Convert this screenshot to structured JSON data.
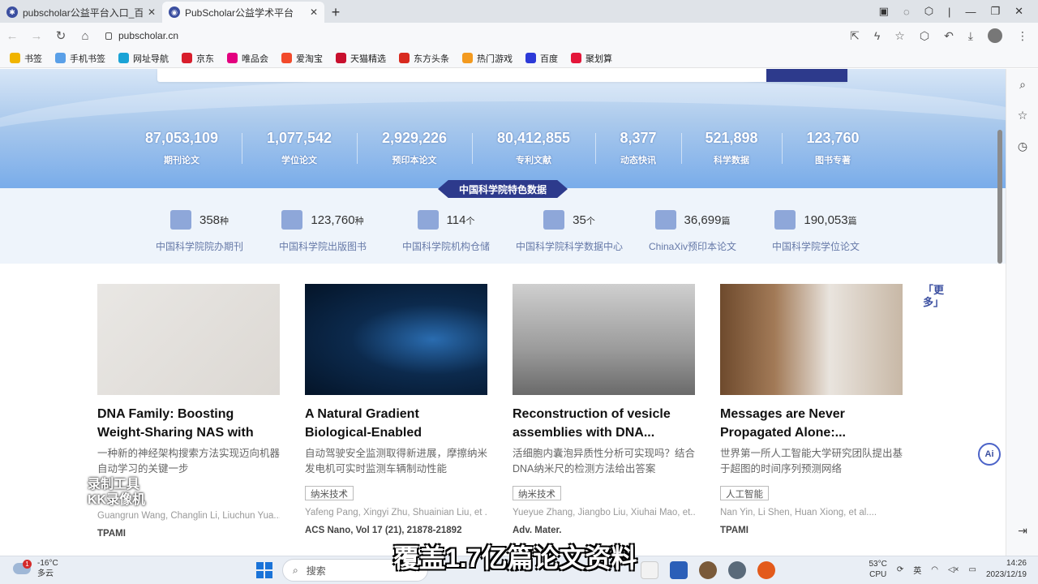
{
  "browser": {
    "tabs": [
      {
        "title": "pubscholar公益平台入口_百度搜",
        "active": false
      },
      {
        "title": "PubScholar公益学术平台",
        "active": true
      }
    ],
    "url": "pubscholar.cn"
  },
  "bookmarks": [
    {
      "label": "书签",
      "icon": "star-icon",
      "color": "#f0b400"
    },
    {
      "label": "手机书签",
      "icon": "folder-icon",
      "color": "#5aa0e8"
    },
    {
      "label": "网址导航",
      "icon": "edge-icon",
      "color": "#1aa3d6"
    },
    {
      "label": "京东",
      "icon": "jd-icon",
      "color": "#d81e2c"
    },
    {
      "label": "唯品会",
      "icon": "vip-icon",
      "color": "#e3007f"
    },
    {
      "label": "爱淘宝",
      "icon": "taobao-icon",
      "color": "#f24a2b"
    },
    {
      "label": "天猫精选",
      "icon": "tmall-icon",
      "color": "#c8102e"
    },
    {
      "label": "东方头条",
      "icon": "toutiao-icon",
      "color": "#d82a1f"
    },
    {
      "label": "热门游戏",
      "icon": "game-icon",
      "color": "#f39a1f"
    },
    {
      "label": "百度",
      "icon": "baidu-icon",
      "color": "#2d3ad8"
    },
    {
      "label": "聚划算",
      "icon": "juhuasuan-icon",
      "color": "#e4173a"
    }
  ],
  "stats": [
    {
      "value": "87,053,109",
      "label": "期刊论文"
    },
    {
      "value": "1,077,542",
      "label": "学位论文"
    },
    {
      "value": "2,929,226",
      "label": "预印本论文"
    },
    {
      "value": "80,412,855",
      "label": "专利文献"
    },
    {
      "value": "8,377",
      "label": "动态快讯"
    },
    {
      "value": "521,898",
      "label": "科学数据"
    },
    {
      "value": "123,760",
      "label": "图书专著"
    }
  ],
  "cas_section": {
    "title": "中国科学院特色数据",
    "items": [
      {
        "num": "358",
        "unit": "种",
        "label": "中国科学院院办期刊",
        "icon": "book-icon"
      },
      {
        "num": "123,760",
        "unit": "种",
        "label": "中国科学院出版图书",
        "icon": "publication-icon"
      },
      {
        "num": "114",
        "unit": "个",
        "label": "中国科学院机构仓储",
        "icon": "repository-icon"
      },
      {
        "num": "35",
        "unit": "个",
        "label": "中国科学院科学数据中心",
        "icon": "database-icon"
      },
      {
        "num": "36,699",
        "unit": "篇",
        "label": "ChinaXiv预印本论文",
        "icon": "preprint-icon"
      },
      {
        "num": "190,053",
        "unit": "篇",
        "label": "中国科学院学位论文",
        "icon": "graduation-cap-icon"
      }
    ]
  },
  "articles": [
    {
      "title": "DNA Family: Boosting Weight-Sharing NAS with Block-Wis...",
      "desc": "一种新的神经架构搜索方法实现迈向机器自动学习的关键一步",
      "tag": "",
      "authors": "Guangrun Wang, Changlin Li, Liuchun Yua...",
      "journal": "TPAMI"
    },
    {
      "title": "A Natural Gradient Biological-Enabled Multimodal...",
      "desc": "自动驾驶安全监测取得新进展，摩擦纳米发电机可实时监测车辆制动性能",
      "tag": "纳米技术",
      "authors": "Yafeng Pang, Xingyi Zhu, Shuainian Liu, et ...",
      "journal": "ACS Nano, Vol 17 (21), 21878-21892"
    },
    {
      "title": "Reconstruction of vesicle assemblies with DNA...",
      "desc": "活细胞内囊泡异质性分析可实现吗？结合DNA纳米尺的检测方法给出答案",
      "tag": "纳米技术",
      "authors": "Yueyue Zhang, Jiangbo Liu, Xiuhai Mao, et...",
      "journal": "Adv. Mater."
    },
    {
      "title": "Messages are Never Propagated Alone:...",
      "desc": "世界第一所人工智能大学研究团队提出基于超图的时间序列预测网络",
      "tag": "人工智能",
      "authors": "Nan Yin, Li Shen, Huan Xiong, et al....",
      "journal": "TPAMI"
    }
  ],
  "more_label": "「更多」",
  "ai_label": "Ai",
  "watermark": {
    "line1": "录制工具",
    "line2": "KK录像机"
  },
  "subtitle": "覆盖1.7亿篇论文资料",
  "taskbar": {
    "weather_temp": "-16°C",
    "weather_desc": "多云",
    "notif_count": "1",
    "search_placeholder": "搜索",
    "cpu_temp": "53°C",
    "cpu_label": "CPU",
    "ime": "英",
    "time": "14:26",
    "date": "2023/12/19"
  }
}
